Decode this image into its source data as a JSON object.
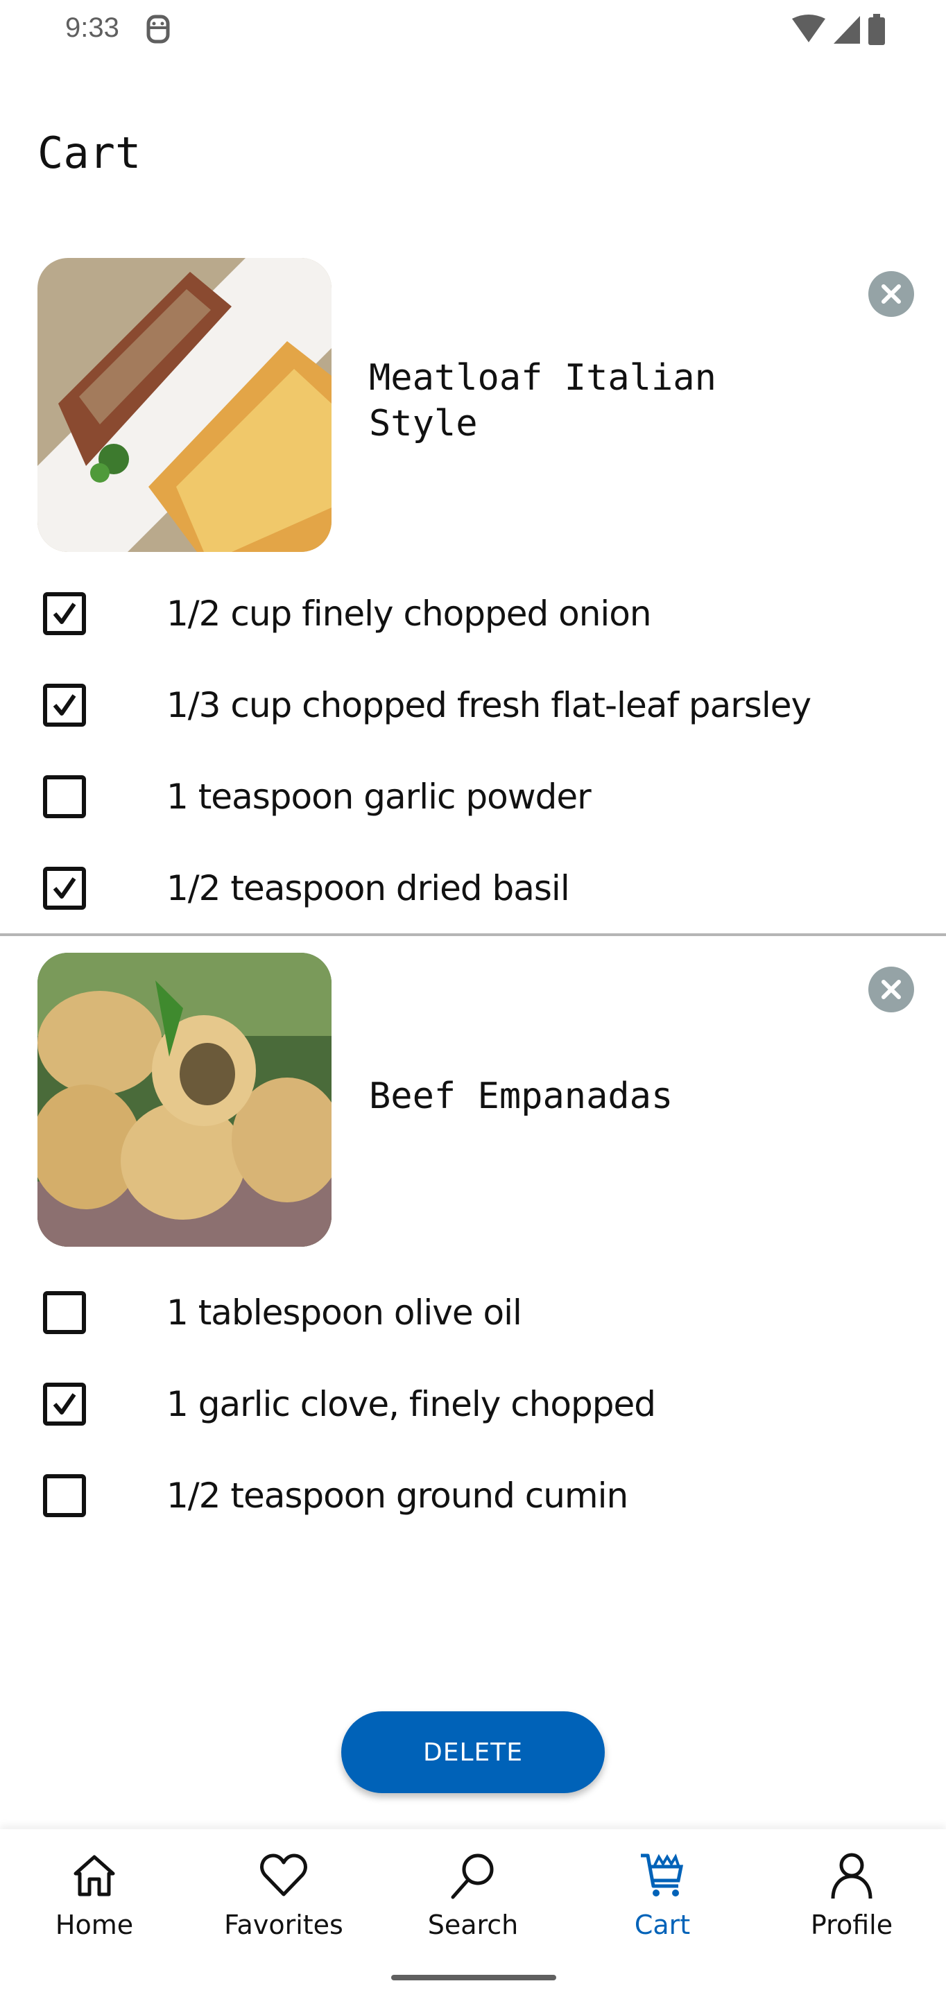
{
  "status_bar": {
    "time": "9:33",
    "icons": [
      "dnd-icon",
      "wifi-icon",
      "signal-icon",
      "battery-icon"
    ]
  },
  "page": {
    "title": "Cart"
  },
  "recipes": [
    {
      "title": "Meatloaf Italian Style",
      "image": "meatloaf-photo",
      "remove_icon": "close-circle-icon",
      "ingredients": [
        {
          "label": "1/2 cup finely chopped onion",
          "checked": true
        },
        {
          "label": "1/3 cup chopped fresh flat-leaf parsley",
          "checked": true
        },
        {
          "label": "1 teaspoon garlic powder",
          "checked": false
        },
        {
          "label": "1/2 teaspoon dried basil",
          "checked": true
        }
      ]
    },
    {
      "title": "Beef Empanadas",
      "image": "empanadas-photo",
      "remove_icon": "close-circle-icon",
      "ingredients": [
        {
          "label": "1 tablespoon olive oil",
          "checked": false
        },
        {
          "label": "1 garlic clove, finely chopped",
          "checked": true
        },
        {
          "label": "1/2 teaspoon ground cumin",
          "checked": false
        }
      ]
    }
  ],
  "actions": {
    "delete_label": "DELETE"
  },
  "bottom_nav": {
    "active": "Cart",
    "items": [
      {
        "label": "Home",
        "icon": "home-icon"
      },
      {
        "label": "Favorites",
        "icon": "heart-icon"
      },
      {
        "label": "Search",
        "icon": "search-icon"
      },
      {
        "label": "Cart",
        "icon": "cart-icon"
      },
      {
        "label": "Profile",
        "icon": "profile-icon"
      }
    ]
  },
  "colors": {
    "accent": "#0062b8",
    "remove_button": "#95a3a6",
    "divider": "#b5b5b5"
  }
}
